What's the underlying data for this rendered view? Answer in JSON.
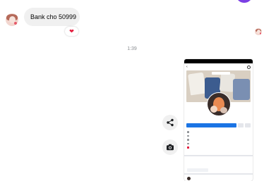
{
  "message": {
    "text": "Bank cho 50999",
    "reaction": "❤"
  },
  "timestamp": "1:39",
  "icons": {
    "share": "share-icon",
    "camera": "camera-icon",
    "heart": "heart-reaction-icon"
  },
  "colors": {
    "accent": "#7b3fe4",
    "bubble": "#f0f0f0",
    "reaction": "#e41e3f",
    "primary_button": "#1b74e4"
  }
}
